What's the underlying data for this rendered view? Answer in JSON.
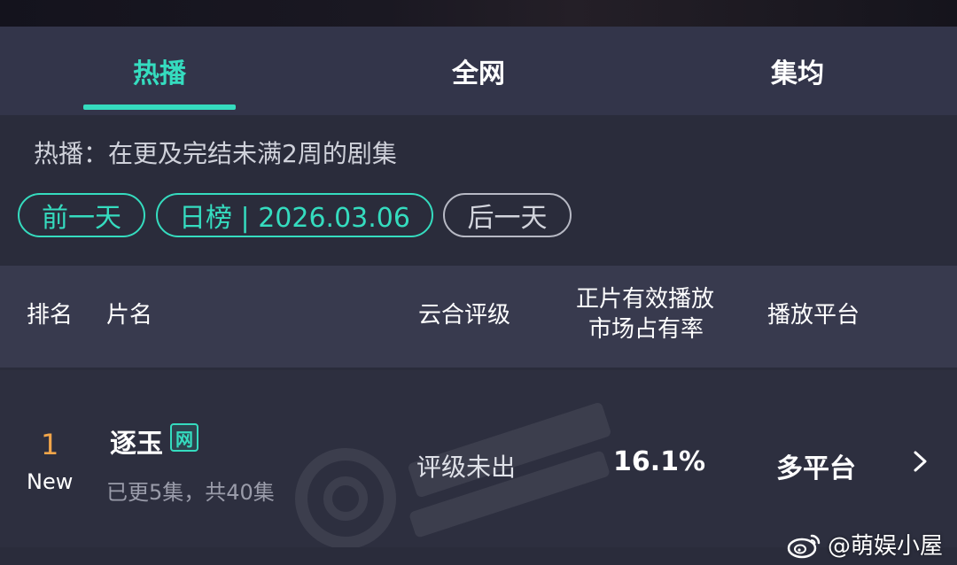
{
  "tabs": [
    {
      "label": "热播",
      "active": true
    },
    {
      "label": "全网",
      "active": false
    },
    {
      "label": "集均",
      "active": false
    }
  ],
  "description": "热播：在更及完结未满2周的剧集",
  "date_nav": {
    "prev_label": "前一天",
    "current_label": "日榜 | 2026.03.06",
    "next_label": "后一天"
  },
  "table": {
    "headers": {
      "rank": "排名",
      "title": "片名",
      "rating": "云合评级",
      "share_line1": "正片有效播放",
      "share_line2": "市场占有率",
      "platform": "播放平台"
    },
    "rows": [
      {
        "rank": "1",
        "rank_badge": "New",
        "title": "逐玉",
        "tag": "网",
        "episodes": "已更5集，共40集",
        "rating": "评级未出",
        "share": "16.1%",
        "platform": "多平台"
      }
    ]
  },
  "watermark": "@萌娱小屋",
  "colors": {
    "accent": "#35dcbf",
    "rank": "#f2a64a",
    "background": "#2a2c3b"
  },
  "icons": [
    "weibo-icon",
    "chevron-right-icon"
  ]
}
